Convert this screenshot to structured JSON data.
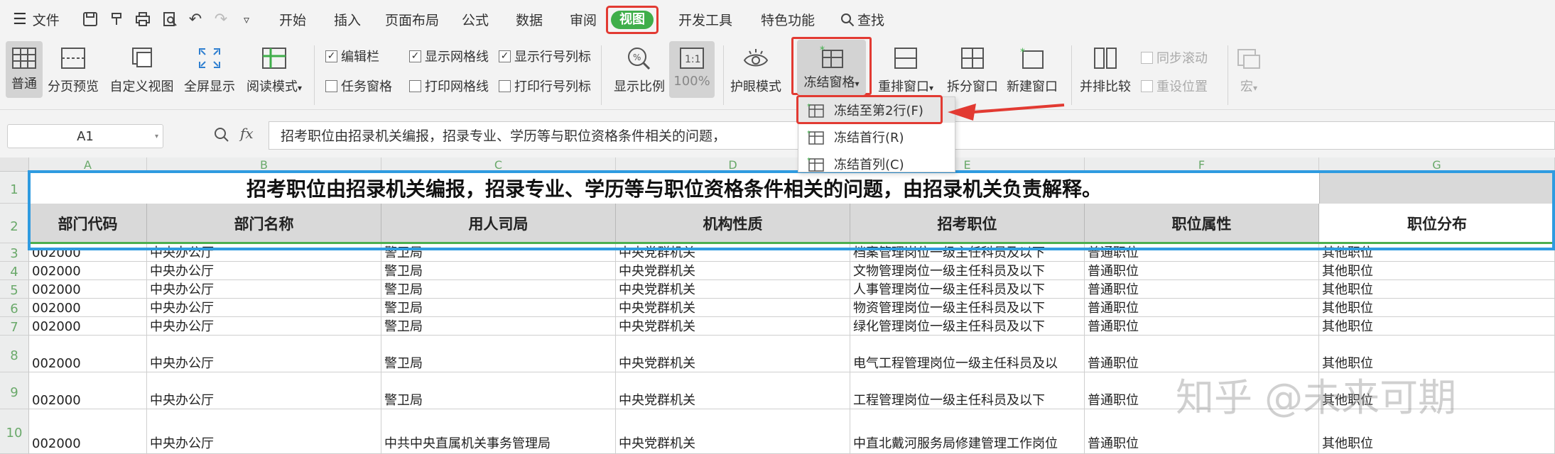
{
  "menubar": {
    "file_label": "文件",
    "tabs": [
      "开始",
      "插入",
      "页面布局",
      "公式",
      "数据",
      "审阅",
      "视图",
      "开发工具",
      "特色功能"
    ],
    "active_tab": "视图",
    "search_label": "查找"
  },
  "ribbon": {
    "buttons": {
      "normal": "普通",
      "page_break": "分页预览",
      "custom_view": "自定义视图",
      "fullscreen": "全屏显示",
      "reading_mode": "阅读模式",
      "zoom_ratio": "显示比例",
      "zoom_100": "100%",
      "eye_care": "护眼模式",
      "freeze_panes": "冻结窗格",
      "rearrange": "重排窗口",
      "split": "拆分窗口",
      "new_window": "新建窗口",
      "side_by_side": "并排比较",
      "macro": "宏"
    },
    "checkboxes": {
      "edit_bar": {
        "label": "编辑栏",
        "checked": true
      },
      "task_pane": {
        "label": "任务窗格",
        "checked": false
      },
      "show_gridlines": {
        "label": "显示网格线",
        "checked": true
      },
      "print_gridlines": {
        "label": "打印网格线",
        "checked": false
      },
      "show_headers": {
        "label": "显示行号列标",
        "checked": true
      },
      "print_headers": {
        "label": "打印行号列标",
        "checked": false
      }
    },
    "disabled": {
      "sync_scroll": "同步滚动",
      "reset_position": "重设位置"
    }
  },
  "freeze_menu": {
    "items": [
      "冻结至第2行(F)",
      "冻结首行(R)",
      "冻结首列(C)"
    ]
  },
  "formula_bar": {
    "name_box": "A1",
    "fx_label": "fx",
    "content": "招考职位由招录机关编报，招录专业、学历等与职位资格条件相关的问题，"
  },
  "sheet": {
    "columns": [
      "A",
      "B",
      "C",
      "D",
      "E",
      "F",
      "G"
    ],
    "row_numbers": [
      "1",
      "2",
      "3",
      "4",
      "5",
      "6",
      "7",
      "8",
      "9",
      "10"
    ],
    "title": "招考职位由招录机关编报，招录专业、学历等与职位资格条件相关的问题，由招录机关负责解释。",
    "headers": [
      "部门代码",
      "部门名称",
      "用人司局",
      "机构性质",
      "招考职位",
      "职位属性",
      "职位分布"
    ],
    "rows": [
      [
        "002000",
        "中央办公厅",
        "警卫局",
        "中央党群机关",
        "档案管理岗位一级主任科员及以下",
        "普通职位",
        "其他职位"
      ],
      [
        "002000",
        "中央办公厅",
        "警卫局",
        "中央党群机关",
        "文物管理岗位一级主任科员及以下",
        "普通职位",
        "其他职位"
      ],
      [
        "002000",
        "中央办公厅",
        "警卫局",
        "中央党群机关",
        "人事管理岗位一级主任科员及以下",
        "普通职位",
        "其他职位"
      ],
      [
        "002000",
        "中央办公厅",
        "警卫局",
        "中央党群机关",
        "物资管理岗位一级主任科员及以下",
        "普通职位",
        "其他职位"
      ],
      [
        "002000",
        "中央办公厅",
        "警卫局",
        "中央党群机关",
        "绿化管理岗位一级主任科员及以下",
        "普通职位",
        "其他职位"
      ],
      [
        "002000",
        "中央办公厅",
        "警卫局",
        "中央党群机关",
        "电气工程管理岗位一级主任科员及以",
        "普通职位",
        "其他职位"
      ],
      [
        "002000",
        "中央办公厅",
        "警卫局",
        "中央党群机关",
        "工程管理岗位一级主任科员及以下",
        "普通职位",
        "其他职位"
      ],
      [
        "002000",
        "中央办公厅",
        "中共中央直属机关事务管理局",
        "中央党群机关",
        "中直北戴河服务局修建管理工作岗位",
        "普通职位",
        "其他职位"
      ]
    ]
  },
  "watermark": "知乎 @未来可期",
  "colors": {
    "active_tab": "#3fae4a",
    "highlight_red": "#e23a32",
    "frozen_blue": "#2f9be0",
    "freeze_line_green": "#4caf50"
  }
}
